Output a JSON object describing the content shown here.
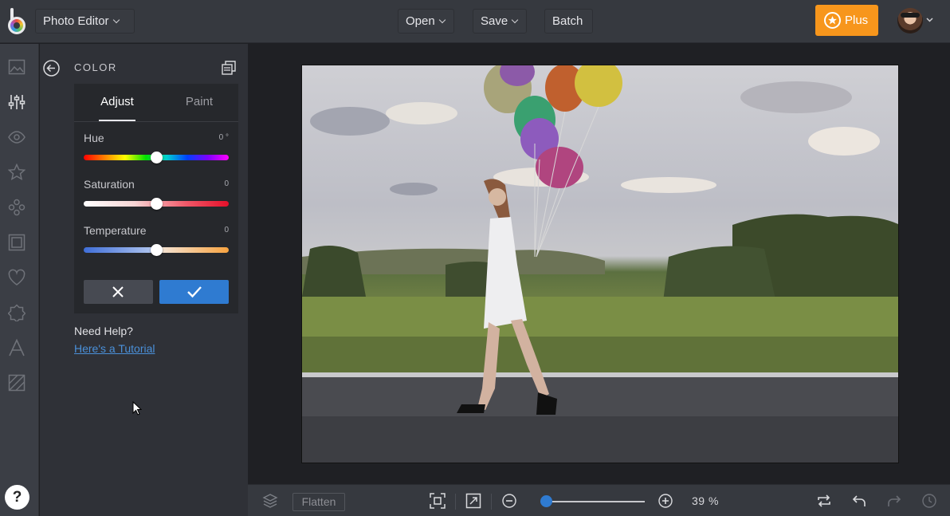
{
  "topbar": {
    "app_menu_label": "Photo Editor",
    "open_label": "Open",
    "save_label": "Save",
    "batch_label": "Batch",
    "plus_label": "Plus"
  },
  "rail": {
    "items": [
      "image-icon",
      "sliders-icon",
      "eye-icon",
      "star-icon",
      "effects-icon",
      "frame-icon",
      "heart-icon",
      "sticker-icon",
      "text-icon",
      "texture-icon"
    ],
    "help_label": "?"
  },
  "panel": {
    "title": "COLOR",
    "tabs": [
      {
        "label": "Adjust",
        "active": true
      },
      {
        "label": "Paint",
        "active": false
      }
    ],
    "sliders": [
      {
        "label": "Hue",
        "value": "0 °",
        "level": 0.5
      },
      {
        "label": "Saturation",
        "value": "0",
        "level": 0.5
      },
      {
        "label": "Temperature",
        "value": "0",
        "level": 0.5
      }
    ],
    "help_question": "Need Help?",
    "help_link": "Here's a Tutorial"
  },
  "bottombar": {
    "flatten_label": "Flatten",
    "zoom_value": "39 %",
    "zoom_level": 0.06
  },
  "colors": {
    "accent": "#2f7bd1",
    "plus": "#f7961c",
    "link": "#4a90d9"
  }
}
